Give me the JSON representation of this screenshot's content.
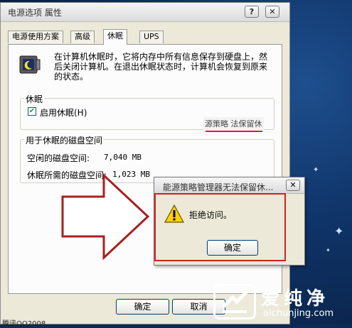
{
  "window": {
    "title": "电源选项 属性",
    "help_label": "?",
    "close_label": "✕"
  },
  "tabs": [
    {
      "label": "电源使用方案"
    },
    {
      "label": "高级"
    },
    {
      "label": "休眠"
    },
    {
      "label": "UPS"
    }
  ],
  "hibernate": {
    "description": "在计算机休眠时，它将内存中所有信息保存到硬盘上，然后关闭计算机。在退出休眠状态时，计算机会恢复到原来的状态。",
    "group_title": "休眠",
    "checkbox_label": "启用休眠(H)",
    "checkbox_checked": true,
    "disk_group_title": "用于休眠的磁盘空间",
    "free_space_label": "空闲的磁盘空间:",
    "free_space_value": "7,040 MB",
    "required_space_label": "休眠所需的磁盘空间:",
    "required_space_value": "1,023 MB",
    "error_tip": "源策略 法保留休"
  },
  "buttons": {
    "ok": "确定",
    "cancel": "取消"
  },
  "status_text": "腾讯QQ2008",
  "dialog": {
    "title": "能源策略管理器无法保留休...",
    "close_label": "✕",
    "message": "拒绝访问。",
    "ok": "确定"
  },
  "watermark": {
    "text": "爱纯净",
    "url": "aichunjing.com"
  },
  "colors": {
    "highlight": "#d62020",
    "desktop": "#0f3468",
    "arrow": "#a82020"
  }
}
